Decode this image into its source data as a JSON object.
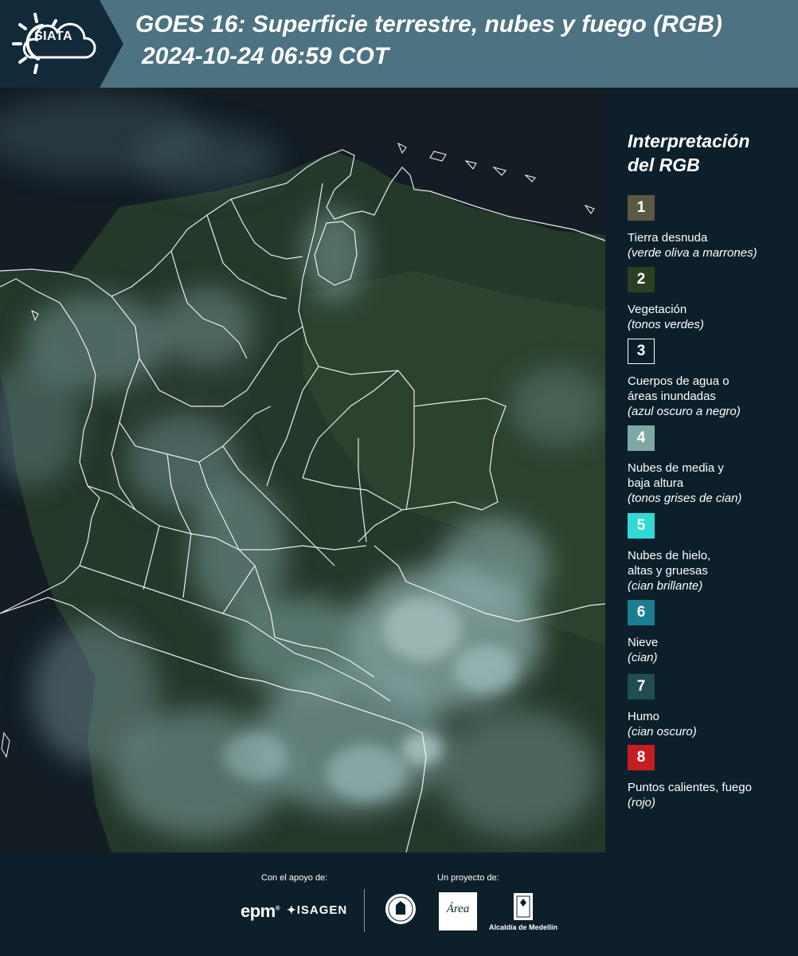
{
  "header": {
    "logo_text": "SIATA",
    "title_line1": "GOES 16: Superficie terrestre, nubes y fuego (RGB)",
    "title_line2": "2024-10-24 06:59 COT"
  },
  "legend": {
    "title_line1": "Interpretación",
    "title_line2": "del RGB",
    "items": [
      {
        "number": "1",
        "label": "Tierra desnuda",
        "hint": "(verde oliva a marrones)",
        "color": "#5a5a42"
      },
      {
        "number": "2",
        "label": "Vegetación",
        "hint": "(tonos verdes)",
        "color": "#2c3f22"
      },
      {
        "number": "3",
        "label_line1": "Cuerpos de agua o",
        "label_line2": "áreas inundadas",
        "hint": "(azul oscuro a negro)",
        "color": "#0c1f2b"
      },
      {
        "number": "4",
        "label_line1": "Nubes de media y",
        "label_line2": "baja altura",
        "hint": "(tonos grises de cian)",
        "color": "#7fa8a5"
      },
      {
        "number": "5",
        "label_line1": "Nubes de hielo,",
        "label_line2": "altas y gruesas",
        "hint": "(cian brillante)",
        "color": "#2fdad6"
      },
      {
        "number": "6",
        "label": "Nieve",
        "hint": "(cian)",
        "color": "#1b7d91"
      },
      {
        "number": "7",
        "label": "Humo",
        "hint": "(cian oscuro)",
        "color": "#1f4d52"
      },
      {
        "number": "8",
        "label": "Puntos calientes, fuego",
        "hint": "(rojo)",
        "color": "#c61d22"
      }
    ]
  },
  "footer": {
    "support_label": "Con el apoyo de:",
    "project_label": "Un proyecto de:",
    "epm": "epm",
    "isagen": "ISAGEN",
    "area_logo_text": "Área",
    "alcaldia": "Alcaldía de Medellín"
  },
  "colors": {
    "header_bg": "#4d7281",
    "panel_bg": "#0c1f2b",
    "ocean": "#141d24",
    "vegetation": "#2a3f26",
    "cloud": "#8fb3b4"
  }
}
